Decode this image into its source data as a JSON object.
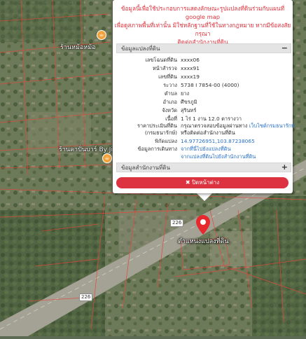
{
  "notice": {
    "line1": "ข้อมูลนี้เพื่อใช้ประกอบการแสดงลักษณะรูปแปลงที่ดินร่วมกับแผนที่ google map",
    "line2": "เพื่อดูสภาพพื้นที่เท่านั้น มิใช่หลักฐานที่ใช้ในทางกฎหมาย หากมีข้อสงสัย กรุณา",
    "line3": "ติดต่อสำนักงานที่ดิน"
  },
  "parcel_section": {
    "title": "ข้อมูลแปลงที่ดิน",
    "toggle": "−"
  },
  "parcel_rows": [
    {
      "key": "เลขโฉนดที่ดิน",
      "value": "xxxx06"
    },
    {
      "key": "หน้าสำรวจ",
      "value": "xxxx91"
    },
    {
      "key": "เลขที่ดิน",
      "value": "xxxx19"
    },
    {
      "key": "ระวาง",
      "value": "5738 I 7854-00 (4000)"
    },
    {
      "key": "ตำบล",
      "value": "ยาง"
    },
    {
      "key": "อำเภอ",
      "value": "ศีขรภูมิ"
    },
    {
      "key": "จังหวัด",
      "value": "สุรินทร์"
    },
    {
      "key": "เนื้อที่",
      "value": "1 ไร่ 1 งาน 12.0 ตารางวา"
    }
  ],
  "price_row": {
    "key1": "ราคาประเมินที่ดิน",
    "key2": "(กรมธนารักษ์)",
    "value_prefix": "กรุณาตรวจสอบข้อมูลผ่านทาง ",
    "value_link": "เว็บไซต์กรมธนารักษ์",
    "value2": "หรือติดต่อสำนักงานที่ดิน"
  },
  "coords_row": {
    "key": "พิกัดแปลง",
    "value": "14.97726951,103.87238065"
  },
  "transaction_row": {
    "key": "ข้อมูลการเดินทาง",
    "link1": "จากที่นี่ไปยังแปลงที่ดิน",
    "link2": "จากแปลงที่ดินไปยังสำนักงานที่ดิน"
  },
  "office_section": {
    "title": "ข้อมูลสำนักงานที่ดิน",
    "toggle": "+"
  },
  "close_button": {
    "icon": "✖",
    "label": "ปิดหน้าต่าง"
  },
  "map": {
    "poi1": "ร้านหม้อหม้อ",
    "poi2": "ร้านคาปั่นบาร์ By Jim",
    "road_badge": "226",
    "pin_label": "ตำแหน่งแปลงที่ดิน",
    "pin_color": "#e8282f",
    "parcel_line_color": "#e8453a"
  }
}
